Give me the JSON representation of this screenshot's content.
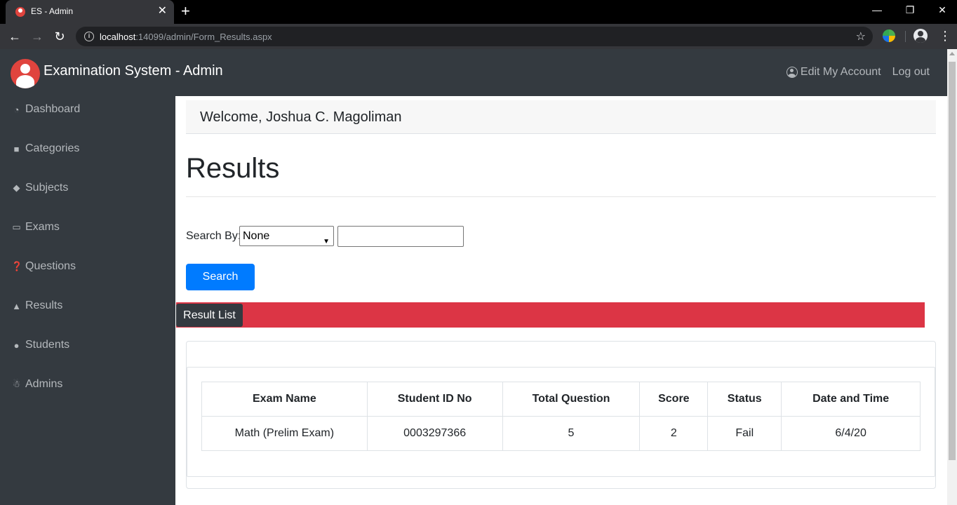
{
  "browser": {
    "tab_title": "ES - Admin",
    "tab_close": "✕",
    "new_tab": "+",
    "url_host": "localhost",
    "url_rest": ":14099/admin/Form_Results.aspx"
  },
  "header": {
    "brand": "Examination System - Admin",
    "edit_account": "Edit My Account",
    "logout": "Log out"
  },
  "sidebar": {
    "items": [
      {
        "label": "Dashboard",
        "icon": "dashboard-icon"
      },
      {
        "label": "Categories",
        "icon": "folder-icon"
      },
      {
        "label": "Subjects",
        "icon": "tag-icon"
      },
      {
        "label": "Exams",
        "icon": "book-icon"
      },
      {
        "label": "Questions",
        "icon": "question-circle-icon"
      },
      {
        "label": "Results",
        "icon": "trophy-icon"
      },
      {
        "label": "Students",
        "icon": "users-icon"
      },
      {
        "label": "Admins",
        "icon": "user-secret-icon"
      }
    ]
  },
  "main": {
    "welcome": "Welcome, Joshua C. Magoliman",
    "title": "Results",
    "search_label": "Search By:",
    "search_select_value": "None",
    "search_input_value": "",
    "search_button": "Search",
    "result_list_tab": "Result List"
  },
  "table": {
    "headers": [
      "Exam Name",
      "Student ID No",
      "Total Question",
      "Score",
      "Status",
      "Date and Time"
    ],
    "rows": [
      [
        "Math (Prelim Exam)",
        "0003297366",
        "5",
        "2",
        "Fail",
        "6/4/20"
      ]
    ]
  },
  "colors": {
    "sidebar_bg": "#343a40",
    "primary": "#007bff",
    "danger": "#dc3545"
  }
}
